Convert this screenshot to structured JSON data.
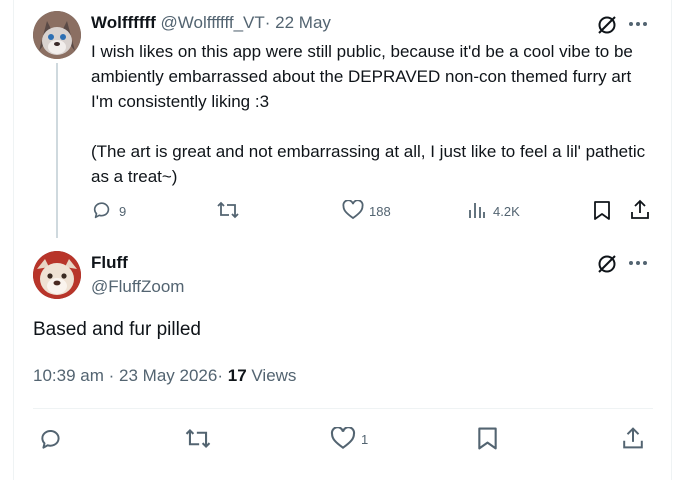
{
  "parent_tweet": {
    "author_name": "Wolffffff",
    "author_handle": "@Wolffffff_VT",
    "separator": "·",
    "date": "22 May",
    "text_paragraphs": [
      "I wish likes on this app were still public, because it'd be a cool vibe to be ambiently embarrassed about the DEPRAVED non-con themed furry art I'm consistently liking :3",
      "(The art is great and not embarrassing at all, I just like to feel a lil' pathetic as a treat~)"
    ],
    "reply_count": "9",
    "like_count": "188",
    "view_count": "4.2K"
  },
  "reply_tweet": {
    "author_name": "Fluff",
    "author_handle": "@FluffZoom",
    "text": "Based and fur pilled",
    "time": "10:39 am",
    "separator": "·",
    "date": "23 May 2026",
    "separator2": "·",
    "views_count": "17",
    "views_label": "Views",
    "like_count": "1"
  },
  "colors": {
    "text_primary": "#0f1419",
    "text_muted": "#536471",
    "thread_line": "#cfd9de",
    "divider": "#eff3f4"
  },
  "icons": {
    "grok": "grok-slash-circle-icon",
    "more": "more-dots-icon",
    "reply": "reply-bubble-icon",
    "repost": "repost-arrows-icon",
    "like": "heart-icon",
    "views": "bar-chart-icon",
    "bookmark": "bookmark-icon",
    "share": "share-upload-icon"
  }
}
